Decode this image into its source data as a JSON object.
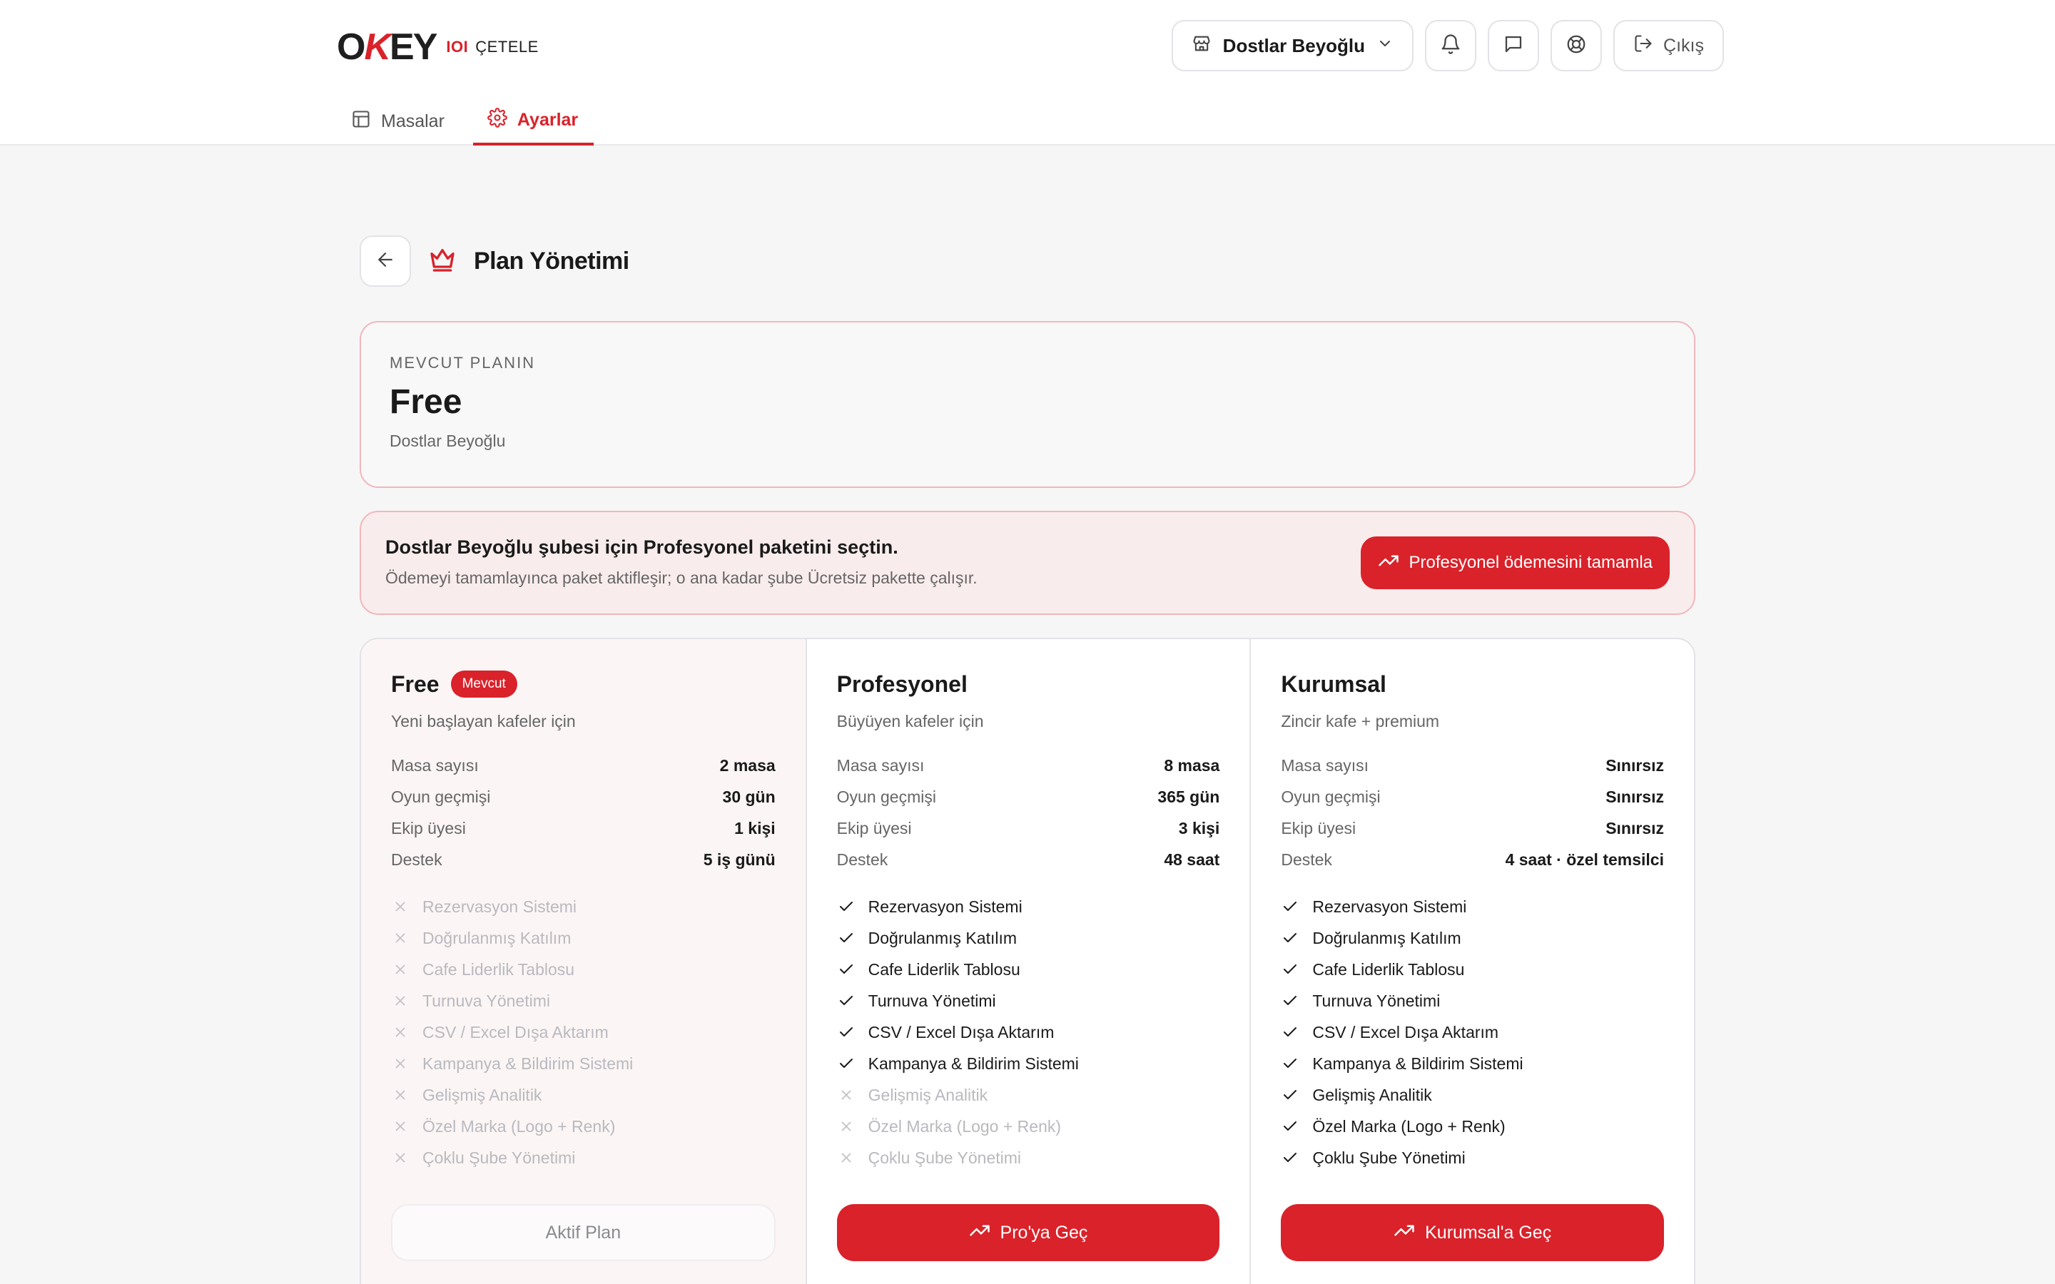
{
  "header": {
    "logo": {
      "main_o": "O",
      "main_k": "K",
      "main_ey": "EY",
      "sub_ioi": "IOI",
      "sub_text": "ÇETELE"
    },
    "branch_select": {
      "label": "Dostlar Beyoğlu"
    },
    "logout_label": "Çıkış",
    "icons": [
      "store-icon",
      "chevron-down-icon",
      "bell-icon",
      "message-icon",
      "support-icon",
      "logout-icon"
    ]
  },
  "tabs": [
    {
      "label": "Masalar",
      "icon": "table-icon",
      "active": false
    },
    {
      "label": "Ayarlar",
      "icon": "gear-icon",
      "active": true
    }
  ],
  "page": {
    "title": "Plan Yönetimi",
    "title_icon": "crown-icon"
  },
  "current_plan": {
    "label": "MEVCUT PLANIN",
    "name": "Free",
    "branch": "Dostlar Beyoğlu"
  },
  "notice": {
    "title": "Dostlar Beyoğlu şubesi için Profesyonel paketini seçtin.",
    "text": "Ödemeyi tamamlayınca paket aktifleşir; o ana kadar şube Ücretsiz pakette çalışır.",
    "button": "Profesyonel ödemesini tamamla"
  },
  "plans": [
    {
      "name": "Free",
      "badge": "Mevcut",
      "desc": "Yeni başlayan kafeler için",
      "specs": [
        {
          "k": "Masa sayısı",
          "v": "2 masa"
        },
        {
          "k": "Oyun geçmişi",
          "v": "30 gün"
        },
        {
          "k": "Ekip üyesi",
          "v": "1 kişi"
        },
        {
          "k": "Destek",
          "v": "5 iş günü"
        }
      ],
      "features": [
        {
          "label": "Rezervasyon Sistemi",
          "on": false
        },
        {
          "label": "Doğrulanmış Katılım",
          "on": false
        },
        {
          "label": "Cafe Liderlik Tablosu",
          "on": false
        },
        {
          "label": "Turnuva Yönetimi",
          "on": false
        },
        {
          "label": "CSV / Excel Dışa Aktarım",
          "on": false
        },
        {
          "label": "Kampanya & Bildirim Sistemi",
          "on": false
        },
        {
          "label": "Gelişmiş Analitik",
          "on": false
        },
        {
          "label": "Özel Marka (Logo + Renk)",
          "on": false
        },
        {
          "label": "Çoklu Şube Yönetimi",
          "on": false
        }
      ],
      "button": "Aktif Plan"
    },
    {
      "name": "Profesyonel",
      "badge": "",
      "desc": "Büyüyen kafeler için",
      "specs": [
        {
          "k": "Masa sayısı",
          "v": "8 masa"
        },
        {
          "k": "Oyun geçmişi",
          "v": "365 gün"
        },
        {
          "k": "Ekip üyesi",
          "v": "3 kişi"
        },
        {
          "k": "Destek",
          "v": "48 saat"
        }
      ],
      "features": [
        {
          "label": "Rezervasyon Sistemi",
          "on": true
        },
        {
          "label": "Doğrulanmış Katılım",
          "on": true
        },
        {
          "label": "Cafe Liderlik Tablosu",
          "on": true
        },
        {
          "label": "Turnuva Yönetimi",
          "on": true
        },
        {
          "label": "CSV / Excel Dışa Aktarım",
          "on": true
        },
        {
          "label": "Kampanya & Bildirim Sistemi",
          "on": true
        },
        {
          "label": "Gelişmiş Analitik",
          "on": false
        },
        {
          "label": "Özel Marka (Logo + Renk)",
          "on": false
        },
        {
          "label": "Çoklu Şube Yönetimi",
          "on": false
        }
      ],
      "button": "Pro'ya Geç"
    },
    {
      "name": "Kurumsal",
      "badge": "",
      "desc": "Zincir kafe + premium",
      "specs": [
        {
          "k": "Masa sayısı",
          "v": "Sınırsız"
        },
        {
          "k": "Oyun geçmişi",
          "v": "Sınırsız"
        },
        {
          "k": "Ekip üyesi",
          "v": "Sınırsız"
        },
        {
          "k": "Destek",
          "v": "4 saat · özel temsilci"
        }
      ],
      "features": [
        {
          "label": "Rezervasyon Sistemi",
          "on": true
        },
        {
          "label": "Doğrulanmış Katılım",
          "on": true
        },
        {
          "label": "Cafe Liderlik Tablosu",
          "on": true
        },
        {
          "label": "Turnuva Yönetimi",
          "on": true
        },
        {
          "label": "CSV / Excel Dışa Aktarım",
          "on": true
        },
        {
          "label": "Kampanya & Bildirim Sistemi",
          "on": true
        },
        {
          "label": "Gelişmiş Analitik",
          "on": true
        },
        {
          "label": "Özel Marka (Logo + Renk)",
          "on": true
        },
        {
          "label": "Çoklu Şube Yönetimi",
          "on": true
        }
      ],
      "button": "Kurumsal'a Geç"
    }
  ],
  "colors": {
    "accent": "#d9222a",
    "border": "#e3e3e7",
    "muted": "#666666",
    "disabled": "#b9b9be"
  }
}
